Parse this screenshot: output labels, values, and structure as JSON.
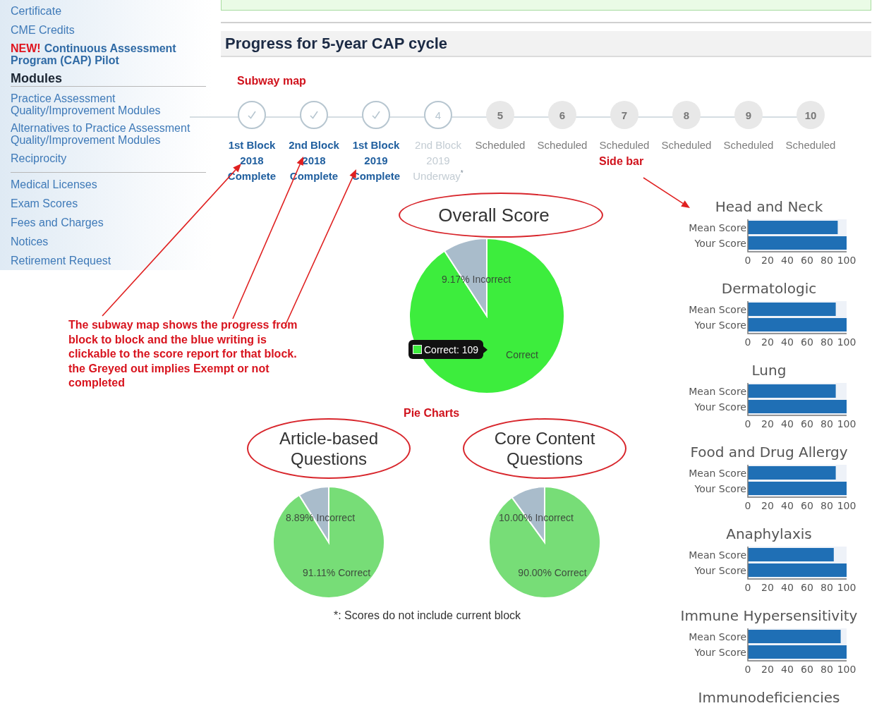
{
  "sidebar": {
    "sections": [
      {
        "items": [
          {
            "label": "Certificate"
          },
          {
            "label": "CME Credits"
          },
          {
            "badge": "NEW!",
            "label": "Continuous Assessment Program (CAP) Pilot"
          }
        ]
      },
      {
        "heading": "Modules",
        "items": [
          {
            "label": "Practice Assessment Quality/Improvement Modules"
          },
          {
            "label": "Alternatives to Practice Assessment Quality/Improvement Modules"
          },
          {
            "label": "Reciprocity"
          }
        ]
      },
      {
        "items": [
          {
            "label": "Medical Licenses"
          },
          {
            "label": "Exam Scores"
          },
          {
            "label": "Fees and Charges"
          },
          {
            "label": "Notices"
          },
          {
            "label": "Retirement Request"
          }
        ]
      }
    ]
  },
  "annotations": {
    "subway": "Subway map",
    "sidebar": "Side bar",
    "pies": "Pie Charts",
    "note": "The subway map shows the progress from block to block and the blue writing is clickable to the score report for that block. the Greyed out implies Exempt or not completed"
  },
  "title": "Progress for 5-year CAP cycle",
  "subway": [
    {
      "kind": "complete",
      "lines": [
        "1st Block",
        "2018",
        "Complete"
      ]
    },
    {
      "kind": "complete",
      "lines": [
        "2nd Block",
        "2018",
        "Complete"
      ]
    },
    {
      "kind": "complete",
      "lines": [
        "1st Block",
        "2019",
        "Complete"
      ]
    },
    {
      "kind": "underway",
      "number": "4",
      "lines": [
        "2nd Block",
        "2019",
        "Underway$^{*}$"
      ]
    },
    {
      "kind": "scheduled",
      "number": "5",
      "lines": [
        "Scheduled"
      ]
    },
    {
      "kind": "scheduled",
      "number": "6",
      "lines": [
        "Scheduled"
      ]
    },
    {
      "kind": "scheduled",
      "number": "7",
      "lines": [
        "Scheduled"
      ]
    },
    {
      "kind": "scheduled",
      "number": "8",
      "lines": [
        "Scheduled"
      ]
    },
    {
      "kind": "scheduled",
      "number": "9",
      "lines": [
        "Scheduled"
      ]
    },
    {
      "kind": "scheduled",
      "number": "10",
      "lines": [
        "Scheduled"
      ]
    }
  ],
  "overall": {
    "title": "Overall Score",
    "tooltip": "Correct: 109",
    "chart_data": {
      "type": "pie",
      "values": [
        90.83,
        9.17
      ],
      "value_labels": [
        "Correct",
        "9.17% Incorrect"
      ]
    }
  },
  "breakdown": [
    {
      "title": "Article-based Questions",
      "chart_data": {
        "type": "pie",
        "values": [
          91.11,
          8.89
        ],
        "value_labels": [
          "91.11% Correct",
          "8.89% Incorrect"
        ]
      }
    },
    {
      "title": "Core Content Questions",
      "chart_data": {
        "type": "pie",
        "values": [
          90,
          10
        ],
        "value_labels": [
          "90.00% Correct",
          "10.00% Incorrect"
        ]
      }
    }
  ],
  "footnote": "*: Scores do not include current block",
  "topics": [
    {
      "title": "Head and Neck",
      "chart_data": {
        "type": "bar",
        "orientation": "horizontal",
        "categories": [
          "Mean Score",
          "Your Score"
        ],
        "values": [
          91,
          100
        ],
        "xlim": [
          0,
          100
        ],
        "xticks": [
          0,
          20,
          40,
          60,
          80,
          100
        ]
      }
    },
    {
      "title": "Dermatologic",
      "chart_data": {
        "type": "bar",
        "orientation": "horizontal",
        "categories": [
          "Mean Score",
          "Your Score"
        ],
        "values": [
          89,
          100
        ],
        "xlim": [
          0,
          100
        ],
        "xticks": [
          0,
          20,
          40,
          60,
          80,
          100
        ]
      }
    },
    {
      "title": "Lung",
      "chart_data": {
        "type": "bar",
        "orientation": "horizontal",
        "categories": [
          "Mean Score",
          "Your Score"
        ],
        "values": [
          89,
          100
        ],
        "xlim": [
          0,
          100
        ],
        "xticks": [
          0,
          20,
          40,
          60,
          80,
          100
        ]
      }
    },
    {
      "title": "Food and Drug Allergy",
      "chart_data": {
        "type": "bar",
        "orientation": "horizontal",
        "categories": [
          "Mean Score",
          "Your Score"
        ],
        "values": [
          89,
          100
        ],
        "xlim": [
          0,
          100
        ],
        "xticks": [
          0,
          20,
          40,
          60,
          80,
          100
        ]
      }
    },
    {
      "title": "Anaphylaxis",
      "chart_data": {
        "type": "bar",
        "orientation": "horizontal",
        "categories": [
          "Mean Score",
          "Your Score"
        ],
        "values": [
          87,
          100
        ],
        "xlim": [
          0,
          100
        ],
        "xticks": [
          0,
          20,
          40,
          60,
          80,
          100
        ]
      }
    },
    {
      "title": "Immune Hypersensitivity",
      "chart_data": {
        "type": "bar",
        "orientation": "horizontal",
        "categories": [
          "Mean Score",
          "Your Score"
        ],
        "values": [
          94,
          100
        ],
        "xlim": [
          0,
          100
        ],
        "xticks": [
          0,
          20,
          40,
          60,
          80,
          100
        ]
      }
    },
    {
      "title": "Immunodeficiencies"
    }
  ]
}
